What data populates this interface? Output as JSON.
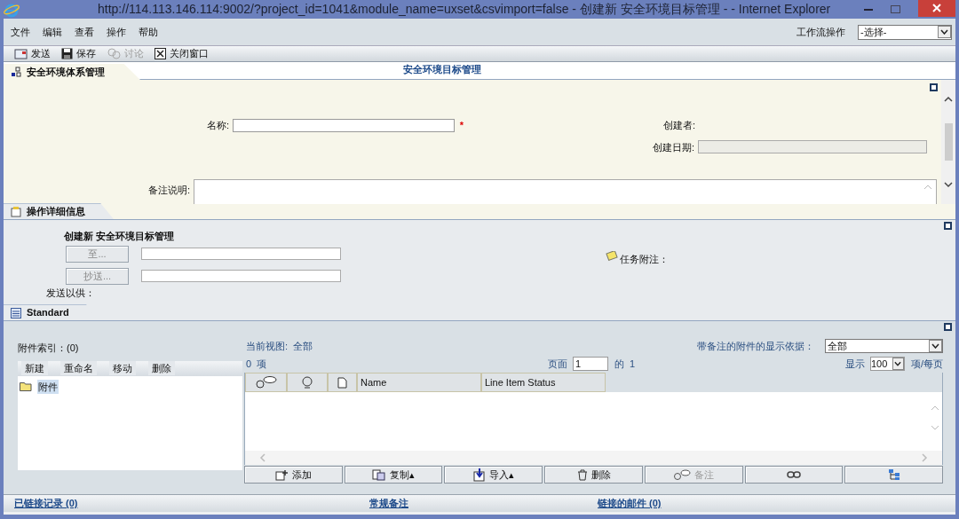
{
  "window": {
    "title": "http://114.113.146.114:9002/?project_id=1041&module_name=uxset&csvimport=false - 创建新 安全环境目标管理 - - Internet Explorer"
  },
  "menu": [
    "文件",
    "编辑",
    "查看",
    "操作",
    "帮助"
  ],
  "workflow": {
    "label": "工作流操作",
    "value": "-选择-"
  },
  "toolbar": [
    {
      "kind": "send",
      "label": "发送",
      "disabled": false
    },
    {
      "kind": "save",
      "label": "保存",
      "disabled": false
    },
    {
      "kind": "discuss",
      "label": "讨论",
      "disabled": true
    },
    {
      "kind": "close",
      "label": "关闭窗口",
      "disabled": false
    }
  ],
  "form_section": {
    "tab": "安全环境体系管理",
    "title": "安全环境目标管理",
    "name_label": "名称:",
    "required_mark": "*",
    "creator_label": "创建者:",
    "date_label": "创建日期:",
    "notes_label": "备注说明:"
  },
  "detail_section": {
    "tab": "操作详细信息",
    "heading": "创建新 安全环境目标管理",
    "to_button": {
      "label": "至...",
      "disabled": true
    },
    "cc_button": {
      "label": "抄送...",
      "disabled": true
    },
    "send_for_label": "发送以供：",
    "task_note_label": "任务附注："
  },
  "standard_section": {
    "tab": "Standard",
    "index_label": "附件索引：(0)",
    "tree_actions": [
      "新建",
      "重命名",
      "移动",
      "删除"
    ],
    "tree": [
      {
        "label": "附件",
        "selected": true
      }
    ],
    "current_view": "当前视图:  全部",
    "filter_label": "带备注的附件的显示依据：",
    "filter_value": "全部",
    "count": "0  项",
    "page_label": "页面",
    "page_value": "1",
    "page_of": "的  1",
    "show_label": "显示",
    "per_page_value": "100",
    "per_page_label": "项/每页",
    "columns": [
      {
        "kind": "note-icon"
      },
      {
        "kind": "tag-icon"
      },
      {
        "kind": "file-icon"
      },
      {
        "kind": "text",
        "label": "Name"
      },
      {
        "kind": "text",
        "label": "Line Item Status"
      }
    ],
    "actions": [
      {
        "kind": "add",
        "label": "添加",
        "disabled": false
      },
      {
        "kind": "copy",
        "label": "复制▴",
        "disabled": false
      },
      {
        "kind": "import",
        "label": "导入▴",
        "disabled": false
      },
      {
        "kind": "delete",
        "label": "删除",
        "disabled": false
      },
      {
        "kind": "note",
        "label": "备注",
        "disabled": true
      },
      {
        "kind": "link"
      },
      {
        "kind": "impact"
      }
    ]
  },
  "footer": [
    "已链接记录 (0)",
    "常规备注",
    "链接的邮件 (0)"
  ]
}
